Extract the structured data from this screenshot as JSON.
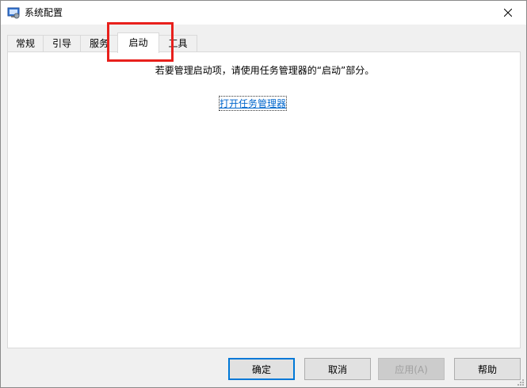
{
  "window": {
    "title": "系统配置",
    "icon": "system-config-icon",
    "close_icon": "close-icon"
  },
  "tabs": [
    {
      "label": "常规",
      "active": false
    },
    {
      "label": "引导",
      "active": false
    },
    {
      "label": "服务",
      "active": false
    },
    {
      "label": "启动",
      "active": true
    },
    {
      "label": "工具",
      "active": false
    }
  ],
  "panel": {
    "message": "若要管理启动项，请使用任务管理器的“启动”部分。",
    "link": "打开任务管理器"
  },
  "buttons": {
    "ok": "确定",
    "cancel": "取消",
    "apply": "应用(A)",
    "help": "帮助"
  },
  "colors": {
    "highlight": "#e8201c",
    "link": "#0066cc",
    "default_button_border": "#0078d7"
  }
}
